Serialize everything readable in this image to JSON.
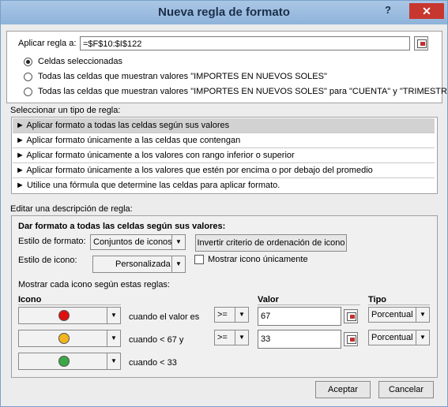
{
  "window": {
    "title": "Nueva regla de formato",
    "help_label": "?",
    "close_label": "✕"
  },
  "apply": {
    "label": "Aplicar regla a:",
    "range_value": "=$F$10:$I$122",
    "options": [
      {
        "label": "Celdas seleccionadas",
        "selected": true
      },
      {
        "label": "Todas las celdas que muestran valores \"IMPORTES EN NUEVOS SOLES\"",
        "selected": false
      },
      {
        "label": "Todas las celdas que muestran valores \"IMPORTES EN NUEVOS SOLES\" para \"CUENTA\" y \"TRIMESTRE\"",
        "selected": false
      }
    ]
  },
  "rule_types": {
    "heading": "Seleccionar un tipo de regla:",
    "items": [
      {
        "label": "► Aplicar formato a todas las celdas según sus valores",
        "selected": true
      },
      {
        "label": "► Aplicar formato únicamente a las celdas que contengan",
        "selected": false
      },
      {
        "label": "► Aplicar formato únicamente a los valores con rango inferior o superior",
        "selected": false
      },
      {
        "label": "► Aplicar formato únicamente a los valores que estén por encima o por debajo del promedio",
        "selected": false
      },
      {
        "label": "► Utilice una fórmula que determine las celdas para aplicar formato.",
        "selected": false
      }
    ]
  },
  "description": {
    "heading": "Editar una descripción de regla:",
    "bold_title": "Dar formato a todas las celdas según sus valores:",
    "format_style_label": "Estilo de formato:",
    "format_style_value": "Conjuntos de iconos",
    "reverse_button": "Invertir criterio de ordenación de icono",
    "icon_style_label": "Estilo de icono:",
    "icon_style_value": "Personalizada",
    "show_icon_only_label": "Mostrar icono únicamente",
    "show_icon_only_checked": false,
    "rules_label": "Mostrar cada icono según estas reglas:",
    "col_icon": "Icono",
    "col_value": "Valor",
    "col_type": "Tipo",
    "rows": [
      {
        "icon_color": "#e01010",
        "condition": "cuando el valor es",
        "operator": ">=",
        "value": "67",
        "type": "Porcentual"
      },
      {
        "icon_color": "#f2b51e",
        "condition": "cuando < 67 y",
        "operator": ">=",
        "value": "33",
        "type": "Porcentual"
      },
      {
        "icon_color": "#3aa845",
        "condition": "cuando < 33"
      }
    ]
  },
  "footer": {
    "ok_label": "Aceptar",
    "cancel_label": "Cancelar"
  }
}
